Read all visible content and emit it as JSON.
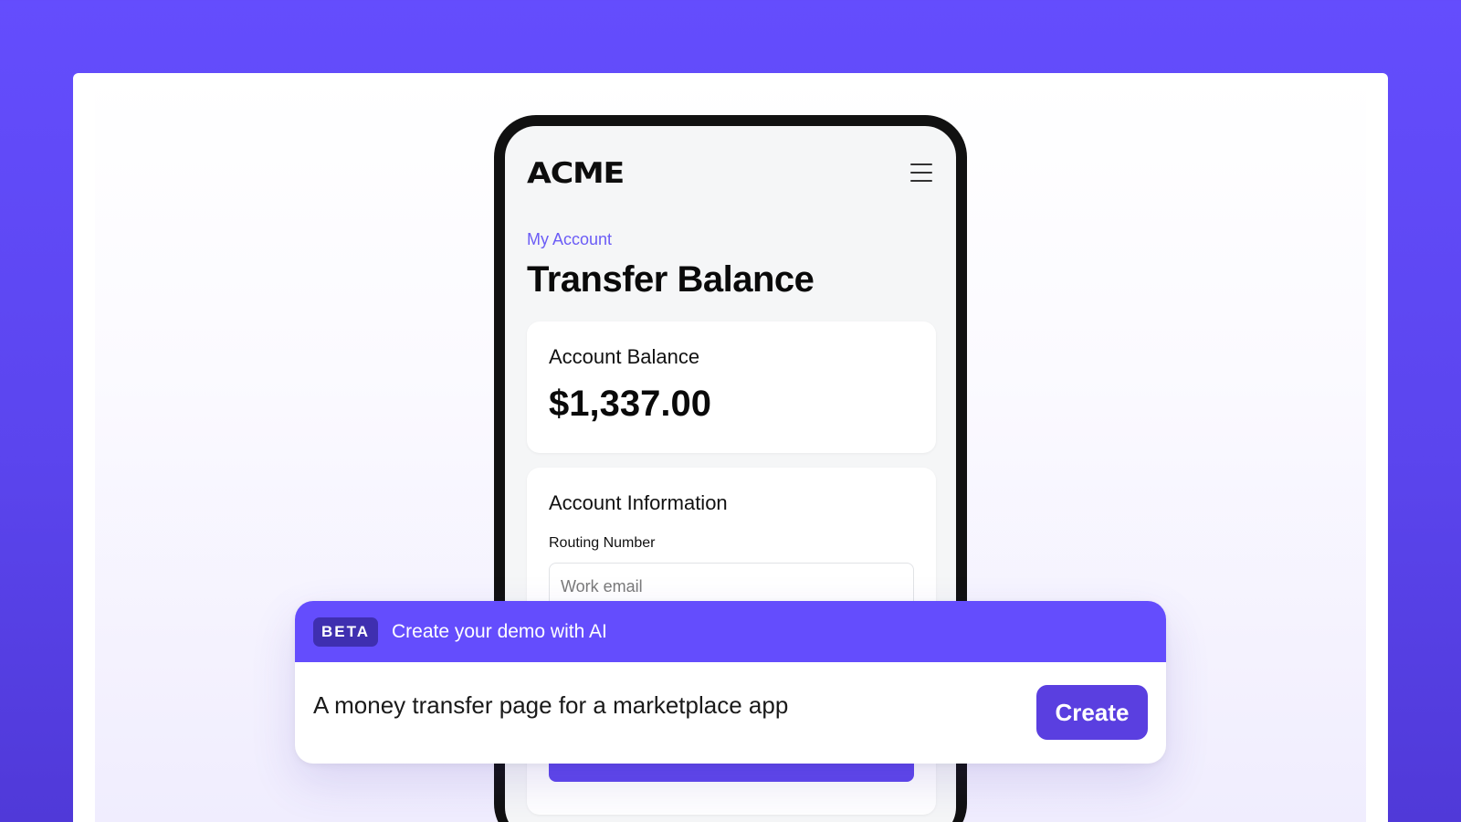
{
  "phone": {
    "logo": "ACME",
    "breadcrumb": "My Account",
    "title": "Transfer Balance",
    "balance_card": {
      "label": "Account Balance",
      "value": "$1,337.00"
    },
    "info_card": {
      "label": "Account Information",
      "field_label": "Routing Number",
      "field_placeholder": "Work email"
    }
  },
  "ai_bar": {
    "badge": "BETA",
    "heading": "Create your demo with AI",
    "prompt_value": "A money transfer page for a marketplace app",
    "create_label": "Create"
  },
  "colors": {
    "brand_purple": "#644dfd",
    "button_purple": "#5a3fe0",
    "accent_text": "#6b5cf6"
  }
}
